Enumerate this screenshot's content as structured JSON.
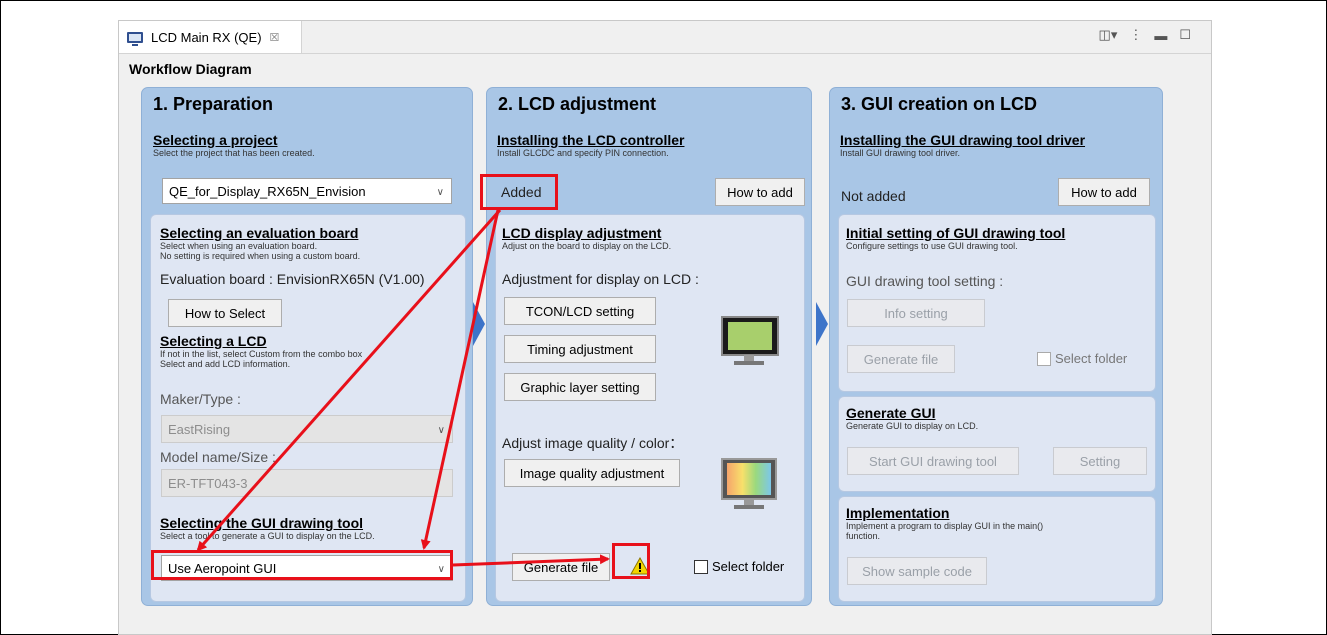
{
  "tab": {
    "title": "LCD Main RX (QE)",
    "close": "☒"
  },
  "workflow_title": "Workflow Diagram",
  "col1": {
    "heading": "1. Preparation",
    "project": {
      "title": "Selecting a project",
      "desc": "Select the project that has been created.",
      "value": "QE_for_Display_RX65N_Envision"
    },
    "board": {
      "title": "Selecting an evaluation board",
      "desc1": "Select when using an evaluation board.",
      "desc2": "No setting is required when using a custom board.",
      "label": "Evaluation board : EnvisionRX65N (V1.00)",
      "button": "How to Select"
    },
    "lcd": {
      "title": "Selecting a LCD",
      "desc1": "If not in the list, select Custom from the combo box",
      "desc2": "Select and add LCD information.",
      "maker_label": "Maker/Type :",
      "maker_value": "EastRising",
      "model_label": "Model name/Size :",
      "model_value": "ER-TFT043-3"
    },
    "gui_tool": {
      "title": "Selecting the GUI drawing tool",
      "desc": "Select a tool to generate a GUI to display on the LCD.",
      "value": "Use Aeropoint GUI"
    }
  },
  "col2": {
    "heading": "2. LCD adjustment",
    "controller": {
      "title": "Installing the LCD controller",
      "desc": "Install GLCDC and specify PIN connection.",
      "status": "Added",
      "button": "How to add"
    },
    "display": {
      "title": "LCD display adjustment",
      "desc": "Adjust on the board to display on the LCD.",
      "adjust_label": "Adjustment for display on LCD :",
      "btn_tcon": "TCON/LCD setting",
      "btn_timing": "Timing adjustment",
      "btn_graphic": "Graphic layer setting",
      "quality_label": "Adjust image quality / color：",
      "btn_quality": "Image quality adjustment",
      "btn_generate": "Generate file",
      "select_folder": "Select folder"
    }
  },
  "col3": {
    "heading": "3. GUI creation on LCD",
    "driver": {
      "title": "Installing the GUI drawing tool driver",
      "desc": "Install GUI drawing tool driver.",
      "status": "Not added",
      "button": "How to add"
    },
    "initial": {
      "title": "Initial setting of GUI drawing tool",
      "desc": "Configure settings to use GUI drawing tool.",
      "label": "GUI drawing tool setting :",
      "btn_info": "Info setting",
      "btn_generate": "Generate file",
      "select_folder": "Select folder"
    },
    "generate_gui": {
      "title": "Generate GUI",
      "desc": "Generate GUI to display on LCD.",
      "btn_start": "Start GUI drawing tool",
      "btn_setting": "Setting"
    },
    "implementation": {
      "title": "Implementation",
      "desc1": "Implement a program to display GUI in the main()",
      "desc2": "function.",
      "btn_sample": "Show sample code"
    }
  },
  "colors": {
    "column_bg": "#a9c6e6",
    "inner_bg": "#dfe6f3",
    "highlight": "#e8101a",
    "chevron": "#3d74c9",
    "warning": "#f2d400"
  }
}
